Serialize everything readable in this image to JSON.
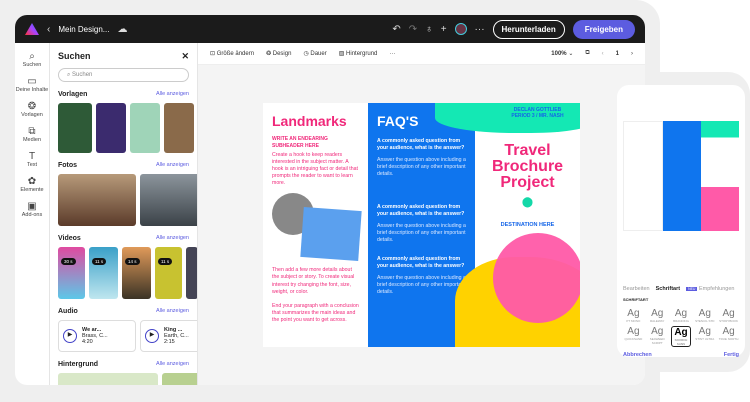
{
  "header": {
    "title": "Mein Design...",
    "download": "Herunterladen",
    "share": "Freigeben"
  },
  "rail": [
    {
      "label": "Suchen",
      "icon": "search-icon"
    },
    {
      "label": "Deine Inhalte",
      "icon": "folder-icon"
    },
    {
      "label": "Vorlagen",
      "icon": "templates-icon"
    },
    {
      "label": "Medien",
      "icon": "media-icon"
    },
    {
      "label": "Text",
      "icon": "text-icon"
    },
    {
      "label": "Elemente",
      "icon": "elements-icon"
    },
    {
      "label": "Add-ons",
      "icon": "addons-icon"
    }
  ],
  "panel": {
    "title": "Suchen",
    "placeholder": "Suchen",
    "see_all": "Alle anzeigen",
    "sections": {
      "templates": "Vorlagen",
      "photos": "Fotos",
      "videos": "Videos",
      "audio": "Audio",
      "background": "Hintergrund"
    },
    "videos": [
      "30 s",
      "11 s",
      "14 s",
      "11 s"
    ],
    "audio": [
      {
        "title": "We ar...",
        "artist": "Brass, C...",
        "duration": "4:20"
      },
      {
        "title": "King ...",
        "artist": "Earth, C...",
        "duration": "2:15"
      }
    ]
  },
  "toolbar": {
    "resize": "Größe ändern",
    "design": "Design",
    "duration": "Dauer",
    "background": "Hintergrund",
    "zoom": "100%",
    "page": "1"
  },
  "brochure": {
    "landmarks": "Landmarks",
    "subheader": "WRITE AN ENDEARING SUBHEADER HERE",
    "p1": "Create a hook to keep readers interested in the subject matter. A hook is an intriguing fact or detail that prompts the reader to want to learn more.",
    "p2": "Then add a few more details about the subject or story. To create visual interest try changing the font, size, weight, or color.",
    "p3": "End your paragraph with a conclusion that summarizes the main ideas and the point you want to get across.",
    "faq": "FAQ'S",
    "q1": "A commonly asked question from your audience, what is the answer?",
    "a1": "Answer the question above including a brief description of any other important details.",
    "q2": "A commonly asked question from your audience, what is the answer?",
    "a2": "Answer the question above including a brief description of any other important details.",
    "q3": "A commonly asked question from your audience, what is the answer?",
    "a3": "Answer the question above including a brief description of any other important details.",
    "name": "DECLAN GOTTLIEB",
    "period": "PERIOD 3 / MR. NASH",
    "title": "Travel Brochure Project",
    "destination": "DESTINATION HERE"
  },
  "phone": {
    "tabs": [
      "Bearbeiten",
      "Schriftart",
      "Empfehlungen"
    ],
    "new_badge": "NEU",
    "section": "SCHRIFTART",
    "fonts": [
      "PT MONO",
      "RALEWAY",
      "BRANDING",
      "STENCIL STD",
      "STORYBOOK",
      "QUICKSAND",
      "SEAWEED SCRIPT",
      "SOURCE SANS",
      "STINT ULTRA",
      "TRUE NORTH"
    ],
    "sample": "Ag",
    "cancel": "Abbrechen",
    "done": "Fertig"
  }
}
